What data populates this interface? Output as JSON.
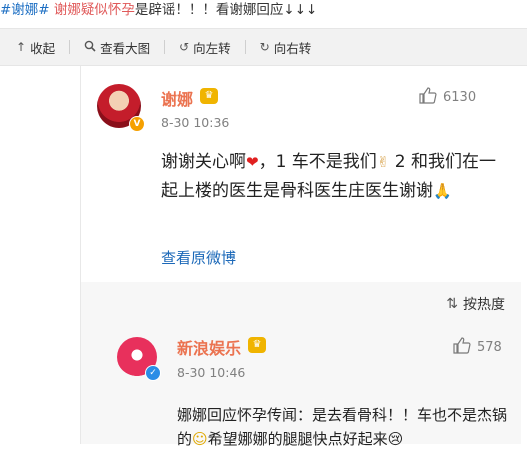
{
  "headline": {
    "tag_text": "#谢娜#",
    "highlight_text": "谢娜疑似怀孕",
    "rest_text": "是辟谣！！！看谢娜回应↓↓↓"
  },
  "toolbar": {
    "collapse_label": "收起",
    "view_large_label": "查看大图",
    "rotate_left_label": "向左转",
    "rotate_right_label": "向右转"
  },
  "main_comment": {
    "author": "谢娜",
    "timestamp": "8-30 10:36",
    "likes": "6130",
    "text_part1": "谢谢关心啊",
    "text_part2": "，1 车不是我们",
    "text_part3": " 2 和我们在一起上楼的医生是骨科医生庄医生谢谢",
    "view_original_label": "查看原微博",
    "heart_icon_glyph": "❤",
    "victory_icon_glyph": "✌",
    "pray_icon_glyph": "🙏"
  },
  "sort": {
    "label": "按热度"
  },
  "reply": {
    "author": "新浪娱乐",
    "timestamp": "8-30 10:46",
    "likes": "578",
    "text_part1": "娜娜回应怀孕传闻：是去看骨科！！车也不是杰锅的",
    "text_part2": "希望娜娜的腿腿快点好起来",
    "smile_icon_glyph": "☺",
    "cry_icon_glyph": "😢"
  },
  "colors": {
    "tag_blue": "#1d6fc3",
    "highlight_red": "#e05a5a",
    "author_orange": "#eb7350",
    "link_blue": "#1b68b8"
  },
  "icons": {
    "collapse": "up-arrow-icon",
    "view_large": "search-icon",
    "rotate_left": "rotate-left-icon",
    "rotate_right": "rotate-right-icon",
    "like": "thumbs-up-icon",
    "sort": "sort-icon",
    "crown": "crown-badge-icon",
    "verified": "verified-badge-icon"
  }
}
